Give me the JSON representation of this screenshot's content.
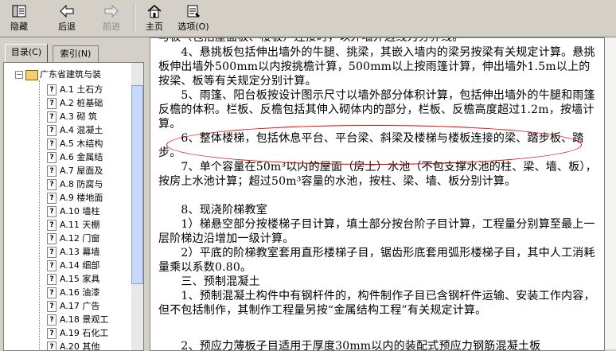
{
  "toolbar": {
    "hide": "隐藏",
    "back": "后退",
    "forward": "前进",
    "home": "主页",
    "options": "选项(O)"
  },
  "tabs": {
    "contents": "目录(C)",
    "index": "索引(N)"
  },
  "tree": {
    "root": "广东省建筑与装",
    "items": [
      "A.1 土石方",
      "A.2 桩基础",
      "A.3 砌 筑",
      "A.4 混凝土",
      "A.5 木结构",
      "A.6 金属结",
      "A.7 屋面及",
      "A.8 防腐与",
      "A.9 楼地面",
      "A.10 墙柱",
      "A.11 天棚",
      "A.12 门窗",
      "A.13 幕墙",
      "A.14 细部",
      "A.15 家具",
      "A.16 油漆",
      "A.17 广告",
      "A.18 景观工",
      "A.19 石化工",
      "A.20 其他"
    ]
  },
  "doc": {
    "p0": "与板（包括屋面板、楼板）连接时，以外墙外边线为分界线。",
    "p1": "　　4、悬挑板包括伸出墙外的牛腿、挑梁，其嵌入墙内的梁另按梁有关规定计算。悬挑板伸出墙外500mm以内按挑檐计算，500mm以上按雨篷计算，伸出墙外1.5m以上的按梁、板等有关规定分别计算。",
    "p2": "　　5、雨篷、阳台板按设计图示尺寸以墙外部分体积计算，包括伸出墙外的牛腿和雨篷反檐的体积。栏板、反檐包括其伸入砌体内的部分，栏板、反檐高度超过1.2m，按墙计算。",
    "p3": "　　6、整体楼梯，包括休息平台、平台梁、斜梁及楼梯与楼板连接的梁、踏步板、踏步。",
    "p4": "　　7、单个容量在50m³以内的屋面（房上）水池（不包支撑水池的柱、梁、墙、板），按房上水池计算；超过50m³容量的水池，按柱、梁、墙、板分别计算。",
    "p5": "　　8、现浇阶梯教室",
    "p6": "　　1）梯悬空部分按楼梯子目计算，填土部分按台阶子目计算，工程量分别算至最上一层阶梯边沿增加一级计算。",
    "p7": "　　2）平底的阶梯教室套用直形楼梯子目，锯齿形底套用弧形楼梯子目，其中人工消耗量乘以系数0.80。",
    "p8": "　　三、预制混凝土",
    "p9": "　　1、预制混凝土构件中有钢杆件的，构件制作子目已含钢杆件运输、安装工作内容，但不包括制作，其制作工程量另按“金属结构工程”有关规定计算。",
    "p10": "　　2、预应力薄板子目适用于厚度30mm以内的装配式预应力钢筋混凝土板"
  }
}
